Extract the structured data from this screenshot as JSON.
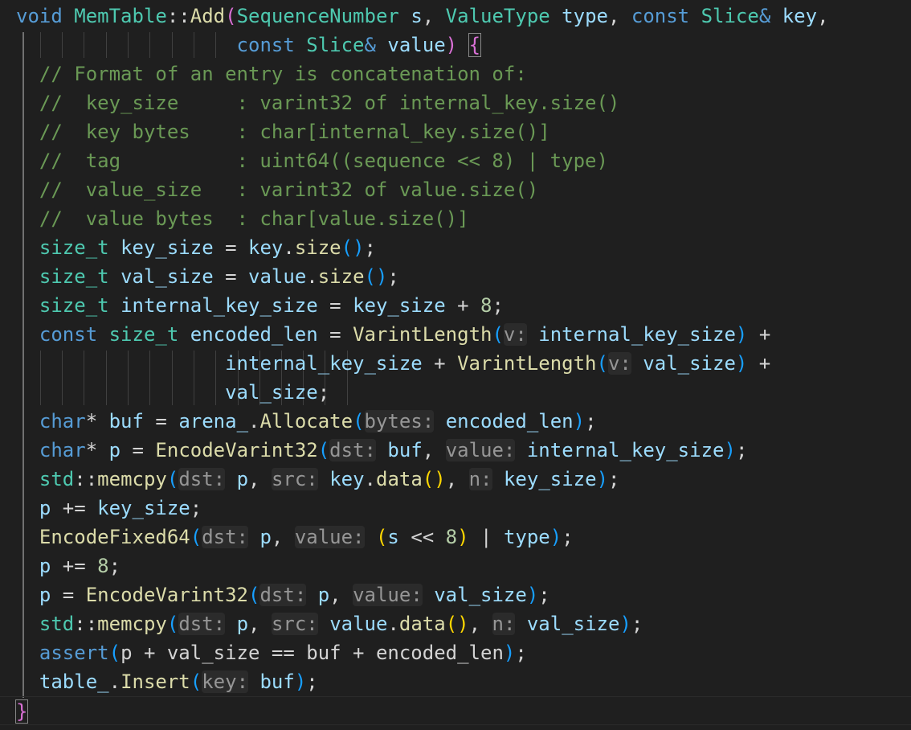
{
  "colors": {
    "background": "#1f1f1f",
    "keyword": "#569cd6",
    "type": "#4ec9b0",
    "function": "#dcdcaa",
    "variable": "#9cdcfe",
    "operator": "#d4d4d4",
    "number": "#b5cea8",
    "comment": "#6a9955",
    "bracket_level_1": "#da70d6",
    "bracket_level_2": "#179fff",
    "bracket_level_3": "#ffd700",
    "inlay_hint_text": "#969696",
    "inlay_hint_background": "#2b2b2b"
  },
  "code": {
    "lines": [
      {
        "tokens": [
          {
            "t": "void",
            "c": "kw"
          },
          {
            "t": " ",
            "c": "op"
          },
          {
            "t": "MemTable",
            "c": "ty"
          },
          {
            "t": "::",
            "c": "op"
          },
          {
            "t": "Add",
            "c": "fn"
          },
          {
            "t": "(",
            "c": "p1"
          },
          {
            "t": "SequenceNumber",
            "c": "ty"
          },
          {
            "t": " ",
            "c": "op"
          },
          {
            "t": "s",
            "c": "var"
          },
          {
            "t": ", ",
            "c": "op"
          },
          {
            "t": "ValueType",
            "c": "ty"
          },
          {
            "t": " ",
            "c": "op"
          },
          {
            "t": "type",
            "c": "var"
          },
          {
            "t": ", ",
            "c": "op"
          },
          {
            "t": "const",
            "c": "kw"
          },
          {
            "t": " ",
            "c": "op"
          },
          {
            "t": "Slice",
            "c": "ty"
          },
          {
            "t": "&",
            "c": "kw"
          },
          {
            "t": " ",
            "c": "op"
          },
          {
            "t": "key",
            "c": "var"
          },
          {
            "t": ",",
            "c": "op"
          }
        ]
      },
      {
        "tokens": [
          {
            "t": "                   ",
            "c": "op"
          },
          {
            "t": "const",
            "c": "kw"
          },
          {
            "t": " ",
            "c": "op"
          },
          {
            "t": "Slice",
            "c": "ty"
          },
          {
            "t": "&",
            "c": "kw"
          },
          {
            "t": " ",
            "c": "op"
          },
          {
            "t": "value",
            "c": "var"
          },
          {
            "t": ")",
            "c": "p1"
          },
          {
            "t": " ",
            "c": "op"
          },
          {
            "t": "{",
            "c": "p1",
            "m": true
          }
        ]
      },
      {
        "tokens": [
          {
            "t": "  // Format of an entry is concatenation of:",
            "c": "cmt"
          }
        ]
      },
      {
        "tokens": [
          {
            "t": "  //  key_size     : varint32 of internal_key.size()",
            "c": "cmt"
          }
        ]
      },
      {
        "tokens": [
          {
            "t": "  //  key bytes    : char[internal_key.size()]",
            "c": "cmt"
          }
        ]
      },
      {
        "tokens": [
          {
            "t": "  //  tag          : uint64((sequence << 8) | type)",
            "c": "cmt"
          }
        ]
      },
      {
        "tokens": [
          {
            "t": "  //  value_size   : varint32 of value.size()",
            "c": "cmt"
          }
        ]
      },
      {
        "tokens": [
          {
            "t": "  //  value bytes  : char[value.size()]",
            "c": "cmt"
          }
        ]
      },
      {
        "tokens": [
          {
            "t": "  ",
            "c": "op"
          },
          {
            "t": "size_t",
            "c": "ty"
          },
          {
            "t": " ",
            "c": "op"
          },
          {
            "t": "key_size",
            "c": "var"
          },
          {
            "t": " = ",
            "c": "op"
          },
          {
            "t": "key",
            "c": "var"
          },
          {
            "t": ".",
            "c": "op"
          },
          {
            "t": "size",
            "c": "fn"
          },
          {
            "t": "()",
            "c": "p2"
          },
          {
            "t": ";",
            "c": "op"
          }
        ]
      },
      {
        "tokens": [
          {
            "t": "  ",
            "c": "op"
          },
          {
            "t": "size_t",
            "c": "ty"
          },
          {
            "t": " ",
            "c": "op"
          },
          {
            "t": "val_size",
            "c": "var"
          },
          {
            "t": " = ",
            "c": "op"
          },
          {
            "t": "value",
            "c": "var"
          },
          {
            "t": ".",
            "c": "op"
          },
          {
            "t": "size",
            "c": "fn"
          },
          {
            "t": "()",
            "c": "p2"
          },
          {
            "t": ";",
            "c": "op"
          }
        ]
      },
      {
        "tokens": [
          {
            "t": "  ",
            "c": "op"
          },
          {
            "t": "size_t",
            "c": "ty"
          },
          {
            "t": " ",
            "c": "op"
          },
          {
            "t": "internal_key_size",
            "c": "var"
          },
          {
            "t": " = ",
            "c": "op"
          },
          {
            "t": "key_size",
            "c": "var"
          },
          {
            "t": " + ",
            "c": "op"
          },
          {
            "t": "8",
            "c": "num"
          },
          {
            "t": ";",
            "c": "op"
          }
        ]
      },
      {
        "tokens": [
          {
            "t": "  ",
            "c": "op"
          },
          {
            "t": "const",
            "c": "kw"
          },
          {
            "t": " ",
            "c": "op"
          },
          {
            "t": "size_t",
            "c": "ty"
          },
          {
            "t": " ",
            "c": "op"
          },
          {
            "t": "encoded_len",
            "c": "var"
          },
          {
            "t": " = ",
            "c": "op"
          },
          {
            "t": "VarintLength",
            "c": "fn"
          },
          {
            "t": "(",
            "c": "p2"
          },
          {
            "t": "v:",
            "c": "hint"
          },
          {
            "t": " ",
            "c": "op"
          },
          {
            "t": "internal_key_size",
            "c": "var"
          },
          {
            "t": ")",
            "c": "p2"
          },
          {
            "t": " +",
            "c": "op"
          }
        ]
      },
      {
        "tokens": [
          {
            "t": "                  ",
            "c": "op"
          },
          {
            "t": "internal_key_size",
            "c": "var"
          },
          {
            "t": " + ",
            "c": "op"
          },
          {
            "t": "VarintLength",
            "c": "fn"
          },
          {
            "t": "(",
            "c": "p2"
          },
          {
            "t": "v:",
            "c": "hint"
          },
          {
            "t": " ",
            "c": "op"
          },
          {
            "t": "val_size",
            "c": "var"
          },
          {
            "t": ")",
            "c": "p2"
          },
          {
            "t": " +",
            "c": "op"
          }
        ]
      },
      {
        "tokens": [
          {
            "t": "                  ",
            "c": "op"
          },
          {
            "t": "val_size",
            "c": "var"
          },
          {
            "t": ";",
            "c": "op"
          }
        ]
      },
      {
        "tokens": [
          {
            "t": "  ",
            "c": "op"
          },
          {
            "t": "char",
            "c": "kw"
          },
          {
            "t": "* ",
            "c": "op"
          },
          {
            "t": "buf",
            "c": "var"
          },
          {
            "t": " = ",
            "c": "op"
          },
          {
            "t": "arena_",
            "c": "var"
          },
          {
            "t": ".",
            "c": "op"
          },
          {
            "t": "Allocate",
            "c": "fn"
          },
          {
            "t": "(",
            "c": "p2"
          },
          {
            "t": "bytes:",
            "c": "hint"
          },
          {
            "t": " ",
            "c": "op"
          },
          {
            "t": "encoded_len",
            "c": "var"
          },
          {
            "t": ")",
            "c": "p2"
          },
          {
            "t": ";",
            "c": "op"
          }
        ]
      },
      {
        "tokens": [
          {
            "t": "  ",
            "c": "op"
          },
          {
            "t": "char",
            "c": "kw"
          },
          {
            "t": "* ",
            "c": "op"
          },
          {
            "t": "p",
            "c": "var"
          },
          {
            "t": " = ",
            "c": "op"
          },
          {
            "t": "EncodeVarint32",
            "c": "fn"
          },
          {
            "t": "(",
            "c": "p2"
          },
          {
            "t": "dst:",
            "c": "hint"
          },
          {
            "t": " ",
            "c": "op"
          },
          {
            "t": "buf",
            "c": "var"
          },
          {
            "t": ", ",
            "c": "op"
          },
          {
            "t": "value:",
            "c": "hint"
          },
          {
            "t": " ",
            "c": "op"
          },
          {
            "t": "internal_key_size",
            "c": "var"
          },
          {
            "t": ")",
            "c": "p2"
          },
          {
            "t": ";",
            "c": "op"
          }
        ]
      },
      {
        "tokens": [
          {
            "t": "  ",
            "c": "op"
          },
          {
            "t": "std",
            "c": "ty"
          },
          {
            "t": "::",
            "c": "op"
          },
          {
            "t": "memcpy",
            "c": "fn"
          },
          {
            "t": "(",
            "c": "p2"
          },
          {
            "t": "dst:",
            "c": "hint"
          },
          {
            "t": " ",
            "c": "op"
          },
          {
            "t": "p",
            "c": "var"
          },
          {
            "t": ", ",
            "c": "op"
          },
          {
            "t": "src:",
            "c": "hint"
          },
          {
            "t": " ",
            "c": "op"
          },
          {
            "t": "key",
            "c": "var"
          },
          {
            "t": ".",
            "c": "op"
          },
          {
            "t": "data",
            "c": "fn"
          },
          {
            "t": "()",
            "c": "p3"
          },
          {
            "t": ", ",
            "c": "op"
          },
          {
            "t": "n:",
            "c": "hint"
          },
          {
            "t": " ",
            "c": "op"
          },
          {
            "t": "key_size",
            "c": "var"
          },
          {
            "t": ")",
            "c": "p2"
          },
          {
            "t": ";",
            "c": "op"
          }
        ]
      },
      {
        "tokens": [
          {
            "t": "  ",
            "c": "op"
          },
          {
            "t": "p",
            "c": "var"
          },
          {
            "t": " += ",
            "c": "op"
          },
          {
            "t": "key_size",
            "c": "var"
          },
          {
            "t": ";",
            "c": "op"
          }
        ]
      },
      {
        "tokens": [
          {
            "t": "  ",
            "c": "op"
          },
          {
            "t": "EncodeFixed64",
            "c": "fn"
          },
          {
            "t": "(",
            "c": "p2"
          },
          {
            "t": "dst:",
            "c": "hint"
          },
          {
            "t": " ",
            "c": "op"
          },
          {
            "t": "p",
            "c": "var"
          },
          {
            "t": ", ",
            "c": "op"
          },
          {
            "t": "value:",
            "c": "hint"
          },
          {
            "t": " ",
            "c": "op"
          },
          {
            "t": "(",
            "c": "p3"
          },
          {
            "t": "s",
            "c": "var"
          },
          {
            "t": " << ",
            "c": "op"
          },
          {
            "t": "8",
            "c": "num"
          },
          {
            "t": ")",
            "c": "p3"
          },
          {
            "t": " | ",
            "c": "op"
          },
          {
            "t": "type",
            "c": "var"
          },
          {
            "t": ")",
            "c": "p2"
          },
          {
            "t": ";",
            "c": "op"
          }
        ]
      },
      {
        "tokens": [
          {
            "t": "  ",
            "c": "op"
          },
          {
            "t": "p",
            "c": "var"
          },
          {
            "t": " += ",
            "c": "op"
          },
          {
            "t": "8",
            "c": "num"
          },
          {
            "t": ";",
            "c": "op"
          }
        ]
      },
      {
        "tokens": [
          {
            "t": "  ",
            "c": "op"
          },
          {
            "t": "p",
            "c": "var"
          },
          {
            "t": " = ",
            "c": "op"
          },
          {
            "t": "EncodeVarint32",
            "c": "fn"
          },
          {
            "t": "(",
            "c": "p2"
          },
          {
            "t": "dst:",
            "c": "hint"
          },
          {
            "t": " ",
            "c": "op"
          },
          {
            "t": "p",
            "c": "var"
          },
          {
            "t": ", ",
            "c": "op"
          },
          {
            "t": "value:",
            "c": "hint"
          },
          {
            "t": " ",
            "c": "op"
          },
          {
            "t": "val_size",
            "c": "var"
          },
          {
            "t": ")",
            "c": "p2"
          },
          {
            "t": ";",
            "c": "op"
          }
        ]
      },
      {
        "tokens": [
          {
            "t": "  ",
            "c": "op"
          },
          {
            "t": "std",
            "c": "ty"
          },
          {
            "t": "::",
            "c": "op"
          },
          {
            "t": "memcpy",
            "c": "fn"
          },
          {
            "t": "(",
            "c": "p2"
          },
          {
            "t": "dst:",
            "c": "hint"
          },
          {
            "t": " ",
            "c": "op"
          },
          {
            "t": "p",
            "c": "var"
          },
          {
            "t": ", ",
            "c": "op"
          },
          {
            "t": "src:",
            "c": "hint"
          },
          {
            "t": " ",
            "c": "op"
          },
          {
            "t": "value",
            "c": "var"
          },
          {
            "t": ".",
            "c": "op"
          },
          {
            "t": "data",
            "c": "fn"
          },
          {
            "t": "()",
            "c": "p3"
          },
          {
            "t": ", ",
            "c": "op"
          },
          {
            "t": "n:",
            "c": "hint"
          },
          {
            "t": " ",
            "c": "op"
          },
          {
            "t": "val_size",
            "c": "var"
          },
          {
            "t": ")",
            "c": "p2"
          },
          {
            "t": ";",
            "c": "op"
          }
        ]
      },
      {
        "tokens": [
          {
            "t": "  ",
            "c": "op"
          },
          {
            "t": "assert",
            "c": "kw"
          },
          {
            "t": "(",
            "c": "p2"
          },
          {
            "t": "p + val_size == buf + encoded_len",
            "c": "op"
          },
          {
            "t": ")",
            "c": "p2"
          },
          {
            "t": ";",
            "c": "op"
          }
        ]
      },
      {
        "tokens": [
          {
            "t": "  ",
            "c": "op"
          },
          {
            "t": "table_",
            "c": "var"
          },
          {
            "t": ".",
            "c": "op"
          },
          {
            "t": "Insert",
            "c": "fn"
          },
          {
            "t": "(",
            "c": "p2"
          },
          {
            "t": "key:",
            "c": "hint"
          },
          {
            "t": " ",
            "c": "op"
          },
          {
            "t": "buf",
            "c": "var"
          },
          {
            "t": ")",
            "c": "p2"
          },
          {
            "t": ";",
            "c": "op"
          }
        ]
      },
      {
        "tokens": [
          {
            "t": "}",
            "c": "p1",
            "m": true
          }
        ],
        "current": true
      }
    ]
  }
}
